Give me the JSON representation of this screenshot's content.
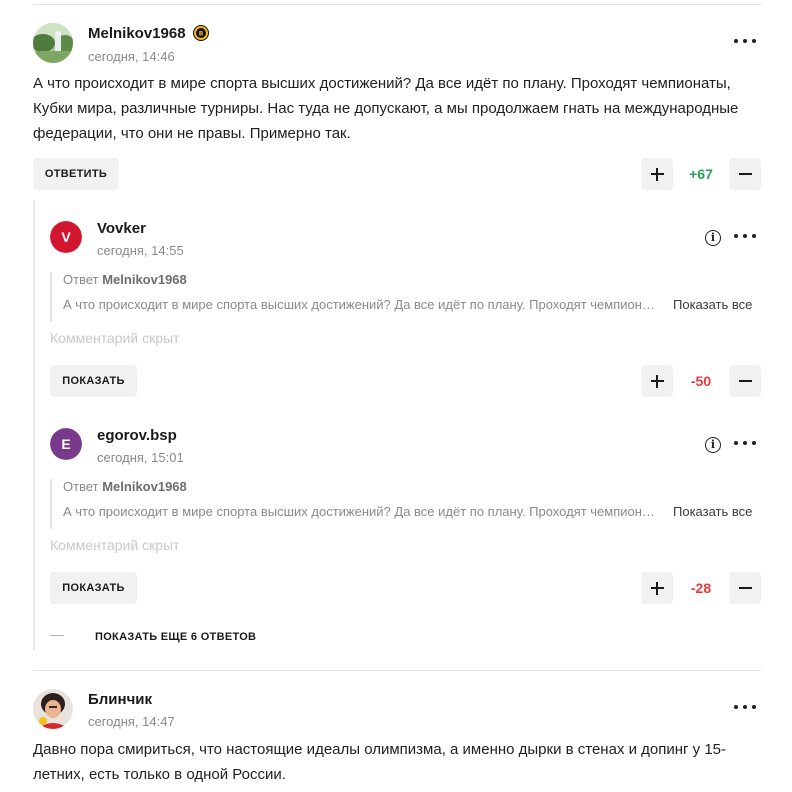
{
  "comments": [
    {
      "author": "Melnikov1968",
      "badge_icon": "hockey-team-badge-icon",
      "time": "сегодня, 14:46",
      "text": "А что происходит в мире спорта высших достижений? Да все идёт по плану. Проходят чемпионаты, Кубки мира, различные турниры. Нас туда не допускают, а мы продолжаем гнать на международные федерации, что они не правы. Примерно так.",
      "reply_label": "ОТВЕТИТЬ",
      "score": "+67"
    },
    {
      "author": "Блинчик",
      "time": "сегодня, 14:47",
      "text": "Давно пора смириться, что настоящие идеалы олимпизма, а именно дырки в стенах и допинг у 15-летних, есть только в одной России."
    }
  ],
  "replies": [
    {
      "author": "Vovker",
      "initial": "V",
      "avatar_color": "#d3162f",
      "time": "сегодня, 14:55",
      "reply_to_label": "Ответ",
      "reply_to_author": "Melnikov1968",
      "quote": "А что происходит в мире спорта высших достижений? Да все идёт по плану. Проходят чемпионаты, Кубки мира, различные турниры.",
      "show_all_label": "Показать все",
      "hidden_label": "Комментарий скрыт",
      "show_label": "ПОКАЗАТЬ",
      "score": "-50"
    },
    {
      "author": "egorov.bsp",
      "initial": "E",
      "avatar_color": "#7a3a8c",
      "time": "сегодня, 15:01",
      "reply_to_label": "Ответ",
      "reply_to_author": "Melnikov1968",
      "quote": "А что происходит в мире спорта высших достижений? Да все идёт по плану. Проходят чемпионаты, Кубки мира, различные турниры.",
      "show_all_label": "Показать все",
      "hidden_label": "Комментарий скрыт",
      "show_label": "ПОКАЗАТЬ",
      "score": "-28"
    }
  ],
  "more_replies_label": "ПОКАЗАТЬ ЕЩЕ 6 ОТВЕТОВ",
  "colors": {
    "positive": "#22a35a",
    "negative": "#e33b3b",
    "button_bg": "#f1f1f1"
  }
}
